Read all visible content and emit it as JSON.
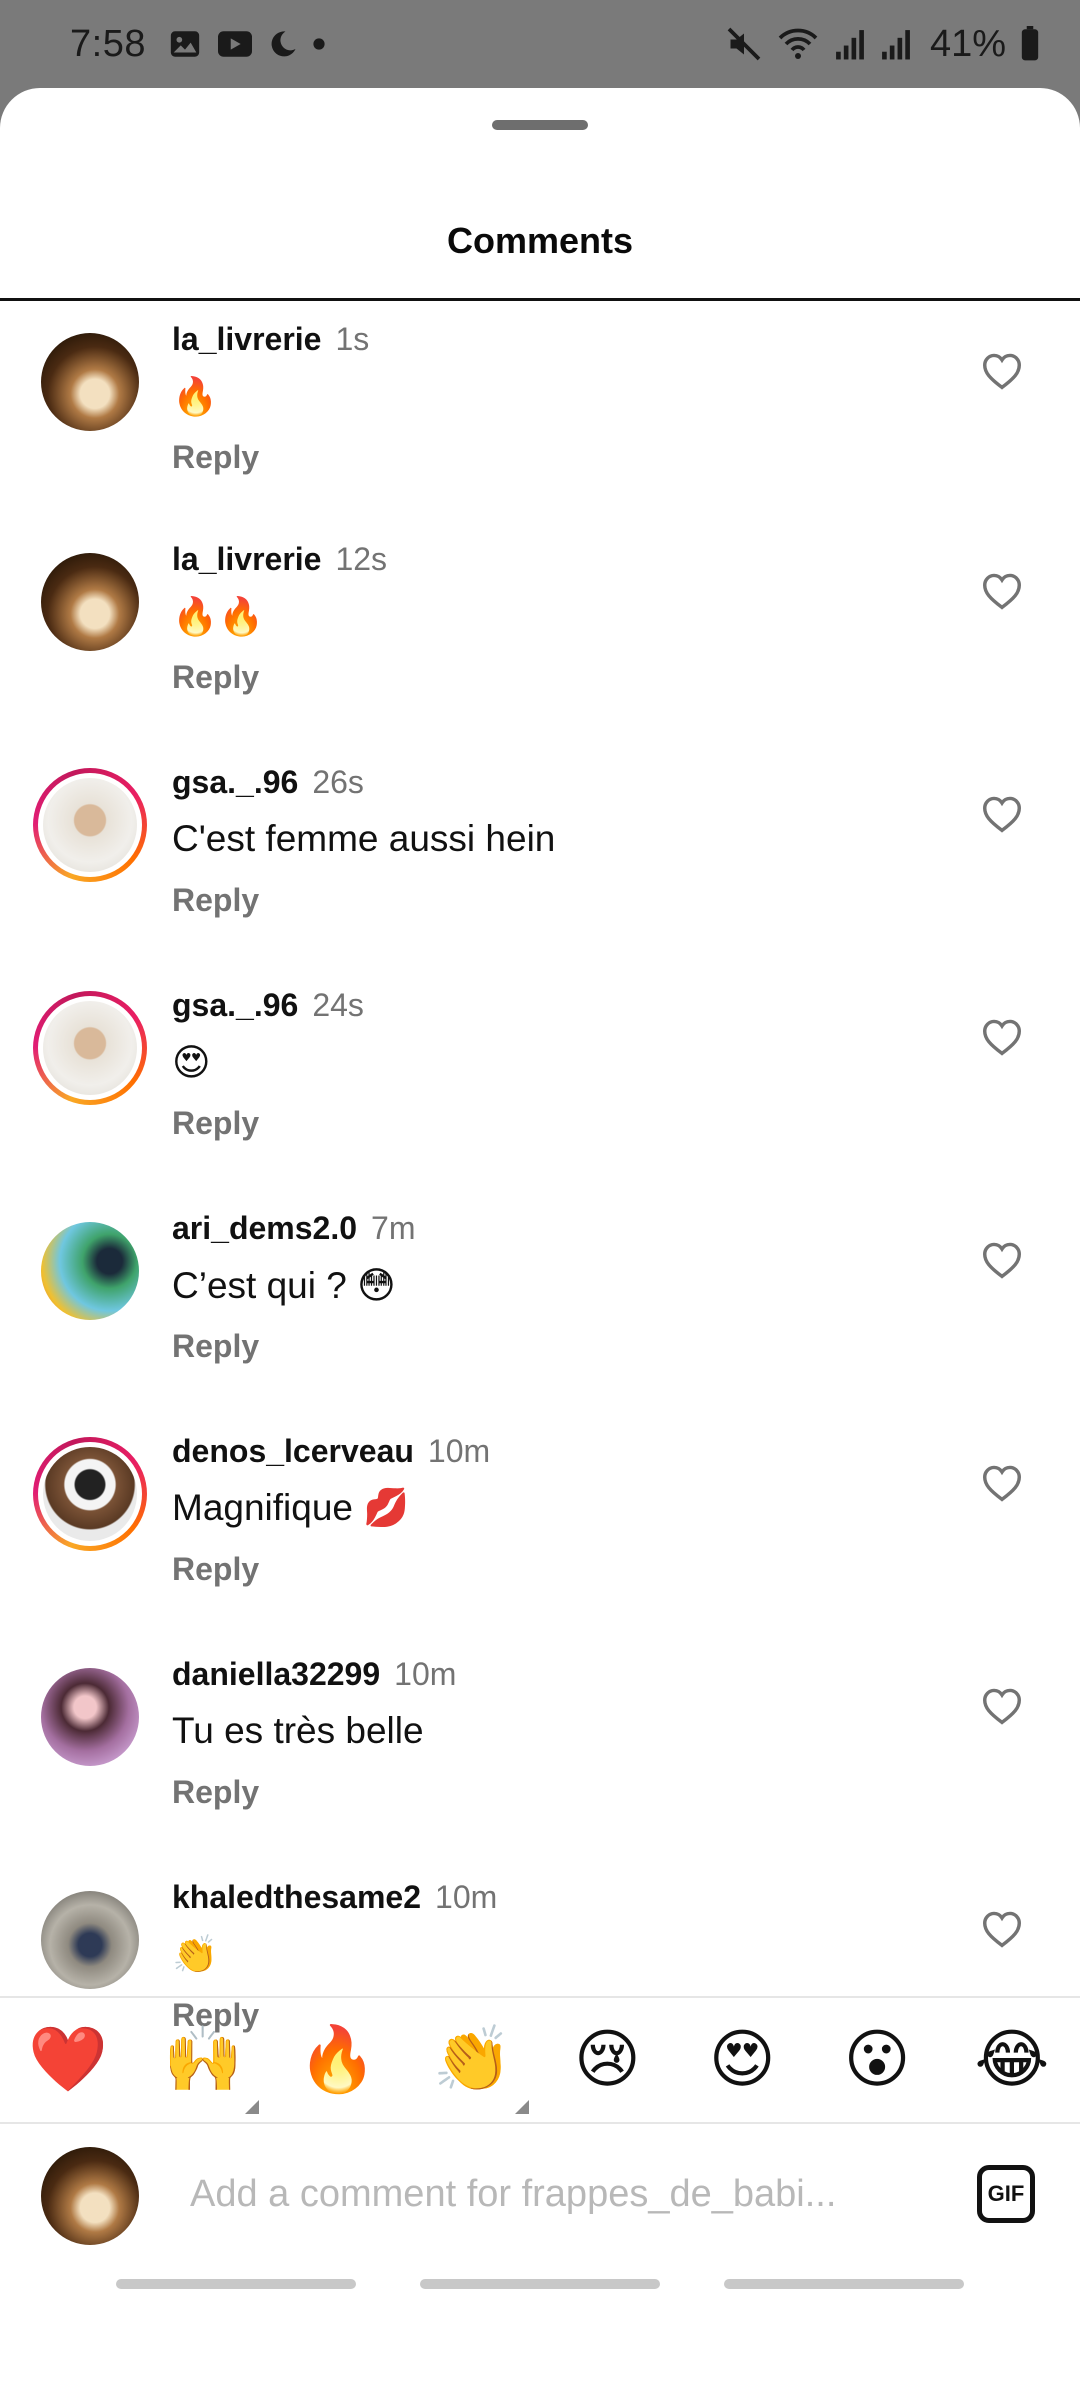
{
  "status_bar": {
    "time": "7:58",
    "battery": "41%",
    "icons": [
      "gallery-icon",
      "youtube-icon",
      "moon-icon",
      "dot-icon",
      "mute-icon",
      "wifi-icon",
      "signal-icon",
      "signal-icon",
      "battery-icon"
    ]
  },
  "sheet": {
    "title": "Comments"
  },
  "comments": [
    {
      "username": "la_livrerie",
      "time": "1s",
      "text": "🔥",
      "reply": "Reply",
      "avatar": "books",
      "story_ring": false
    },
    {
      "username": "la_livrerie",
      "time": "12s",
      "text": "🔥🔥",
      "reply": "Reply",
      "avatar": "books",
      "story_ring": false
    },
    {
      "username": "gsa._.96",
      "time": "26s",
      "text": "C'est femme aussi hein",
      "reply": "Reply",
      "avatar": "man",
      "story_ring": true
    },
    {
      "username": "gsa._.96",
      "time": "24s",
      "text": "😍",
      "reply": "Reply",
      "avatar": "man",
      "story_ring": true
    },
    {
      "username": "ari_dems2.0",
      "time": "7m",
      "text": "C’est qui ? 😳",
      "reply": "Reply",
      "avatar": "ari",
      "story_ring": false
    },
    {
      "username": "denos_lcerveau",
      "time": "10m",
      "text": "Magnifique 💋",
      "reply": "Reply",
      "avatar": "denos",
      "story_ring": true
    },
    {
      "username": "daniella32299",
      "time": "10m",
      "text": "Tu es très belle",
      "reply": "Reply",
      "avatar": "dani",
      "story_ring": false
    },
    {
      "username": "khaledthesame2",
      "time": "10m",
      "text": "👏",
      "reply": "Reply",
      "avatar": "khaled",
      "story_ring": false
    }
  ],
  "reactions": [
    "❤️",
    "🙌",
    "🔥",
    "👏",
    "😢",
    "😍",
    "😮",
    "😂"
  ],
  "composer": {
    "placeholder": "Add a comment for frappes_de_babi...",
    "gif_label": "GIF"
  },
  "colors": {
    "status_bar_bg": "#7a7a7a",
    "secondary_text": "#737373",
    "story_ring": "#e11d74"
  }
}
